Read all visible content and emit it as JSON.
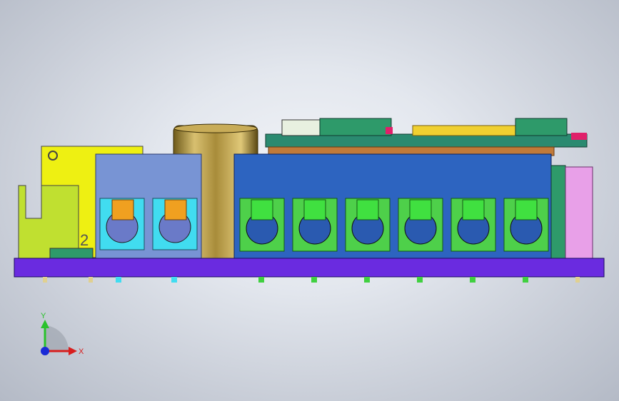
{
  "viewport": {
    "model_label": "2",
    "triad": {
      "x_label": "X",
      "y_label": "Y"
    },
    "colors": {
      "board": "#6a2be0",
      "large_terminal_block": "#2d64c0",
      "small_terminal_block": "#7894d4",
      "terminal_clamp": "#4ed04a",
      "small_terminal_clamp": "#41dcf0",
      "orange_screw": "#f0a020",
      "capacitor": "#c8a84a",
      "yellow_part": "#eef012",
      "lime_part": "#c0e030",
      "pink_part": "#e8a0e8",
      "teal_pcb": "#2a8a70"
    }
  }
}
